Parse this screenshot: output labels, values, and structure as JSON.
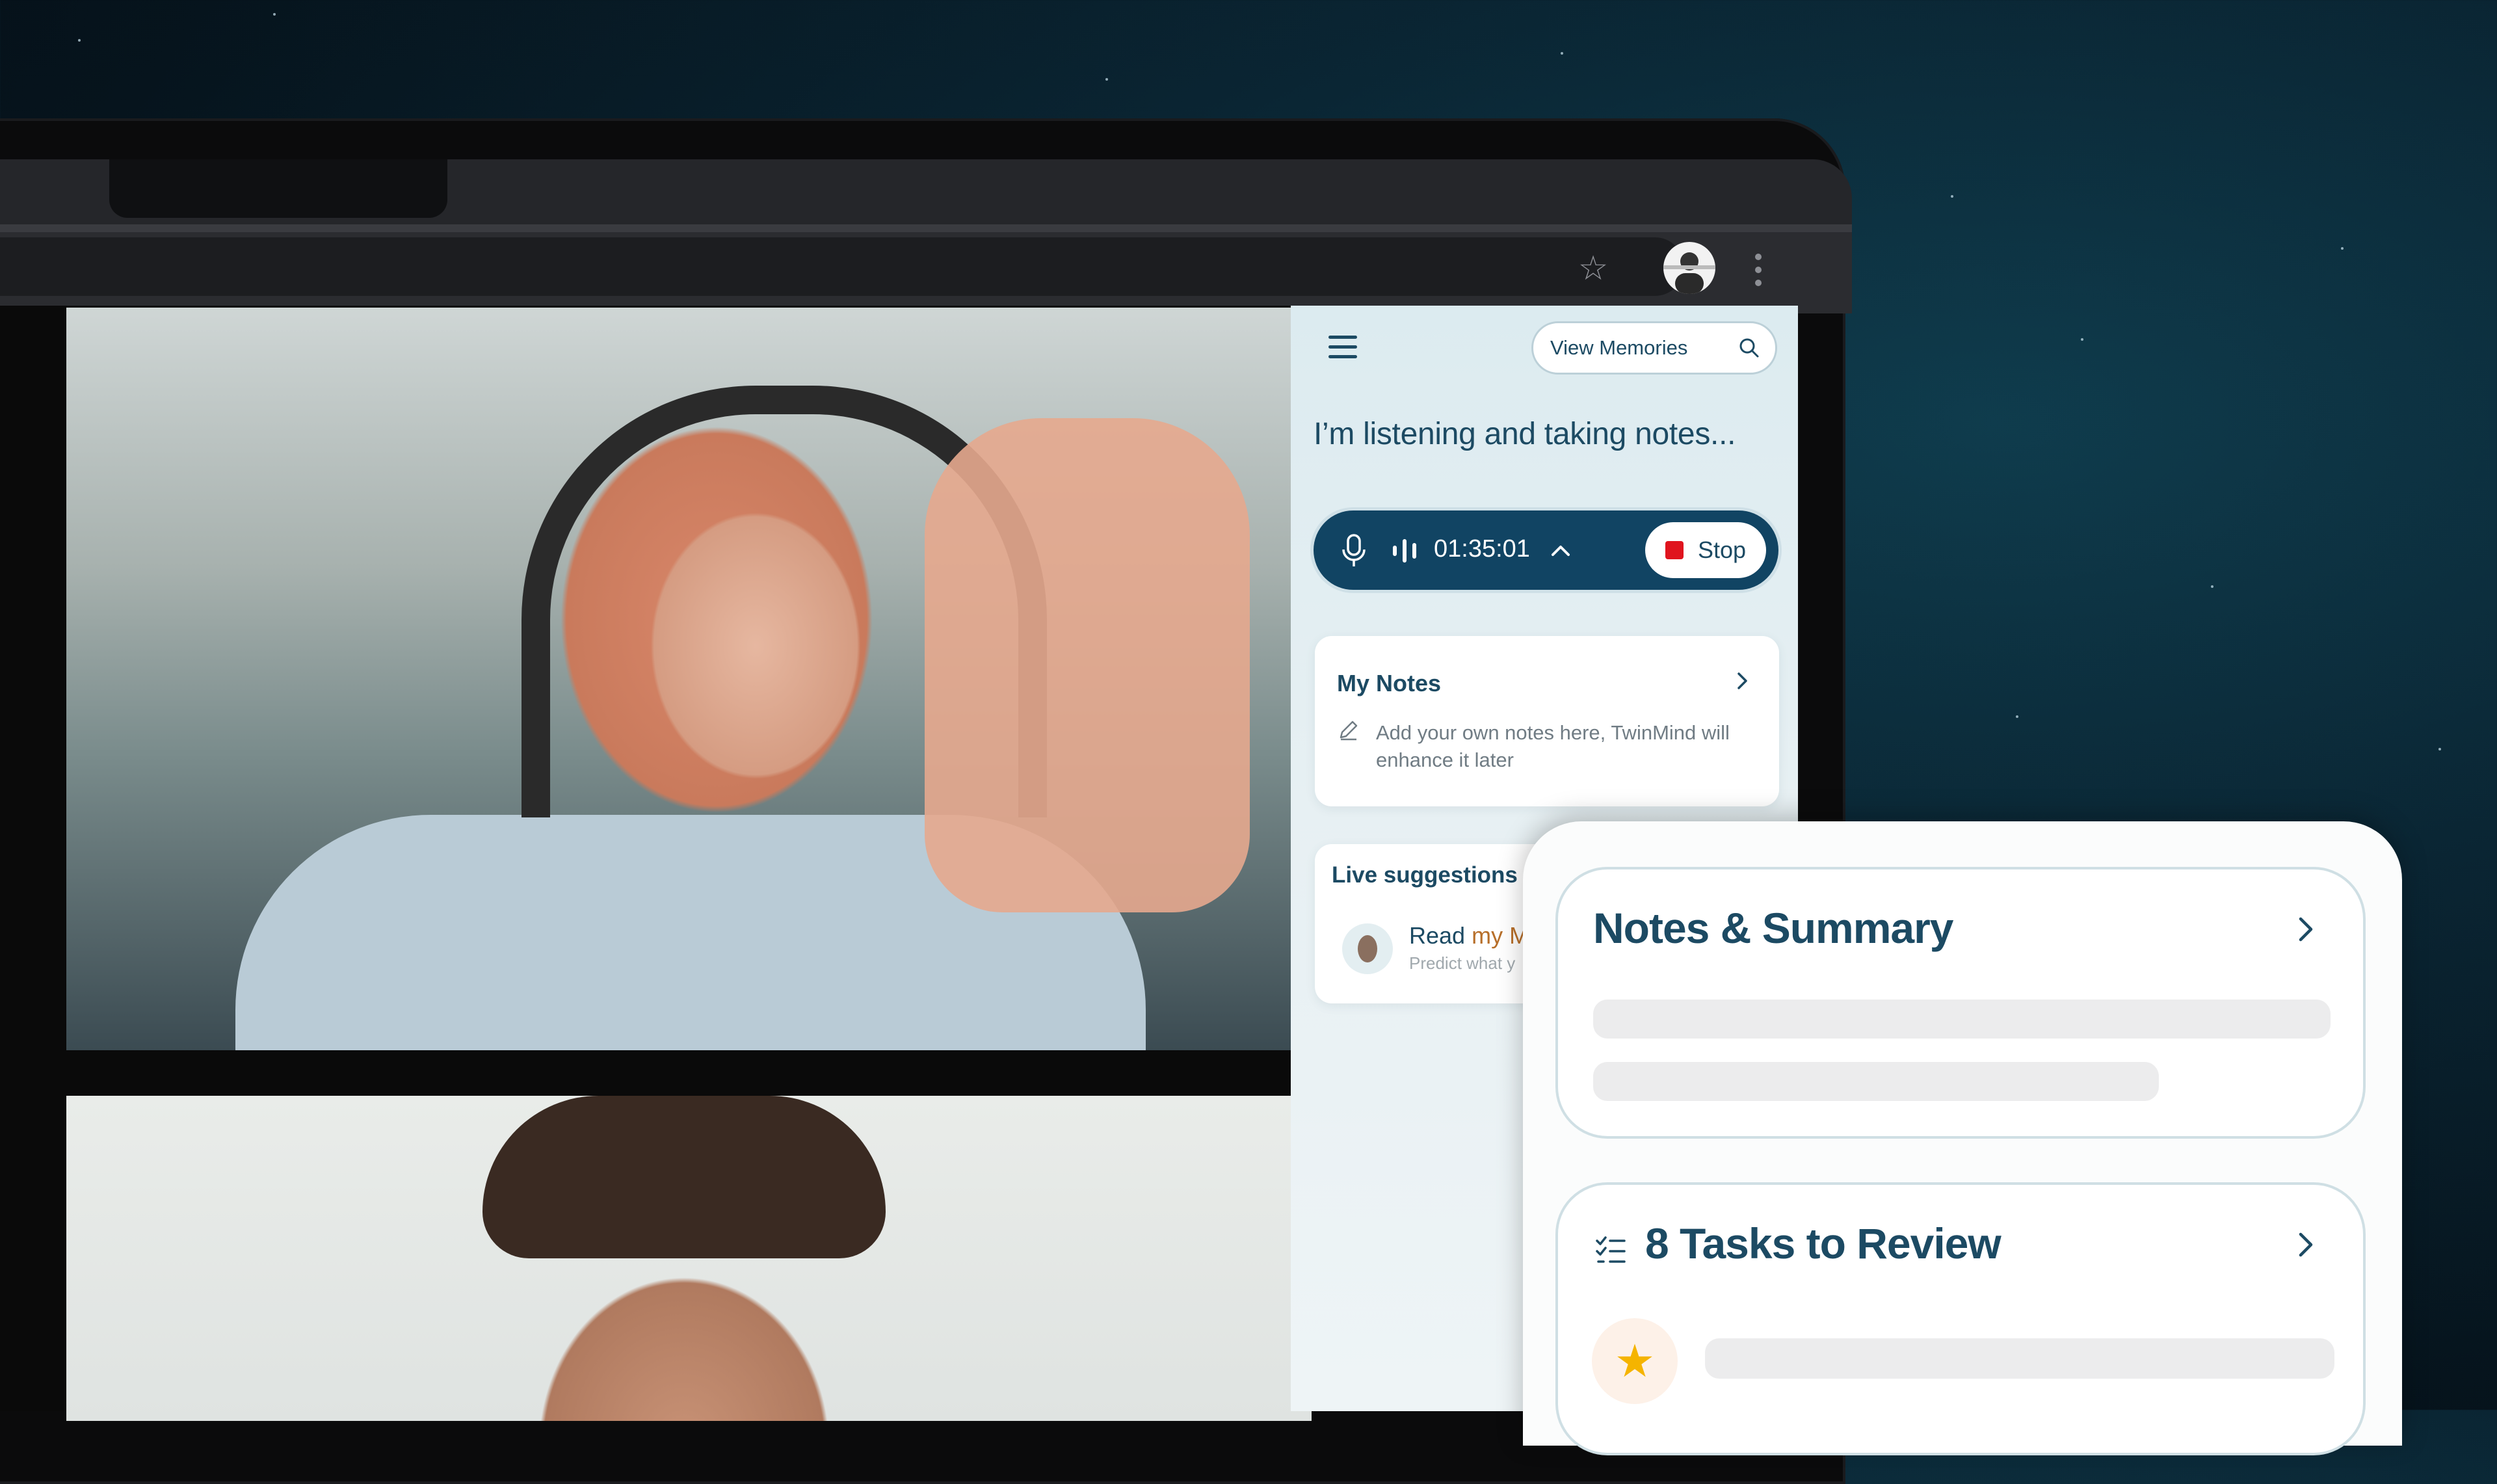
{
  "browser": {
    "bookmark_icon": "star-outline-icon",
    "profile_icon": "profile-avatar",
    "menu_icon": "kebab-menu-icon"
  },
  "sidepanel": {
    "menu_icon": "hamburger-menu-icon",
    "view_memories_label": "View Memories",
    "search_icon": "search-icon",
    "status_text": "I’m listening and taking notes...",
    "recorder": {
      "timer": "01:35:01",
      "stop_label": "Stop"
    },
    "my_notes": {
      "title": "My Notes",
      "hint": "Add your own notes here, TwinMind will enhance it later"
    },
    "live_suggestions": {
      "title": "Live suggestions",
      "suggestion_prefix": "Read ",
      "suggestion_accent": "my M",
      "suggestion_sub": "Predict what y"
    }
  },
  "phone": {
    "summary_title": "Notes & Summary",
    "tasks_title": "8 Tasks to Review"
  },
  "colors": {
    "brand_navy": "#114463",
    "text_navy": "#1c4a63",
    "stop_red": "#e0141e",
    "accent_orange": "#b76f2a"
  }
}
